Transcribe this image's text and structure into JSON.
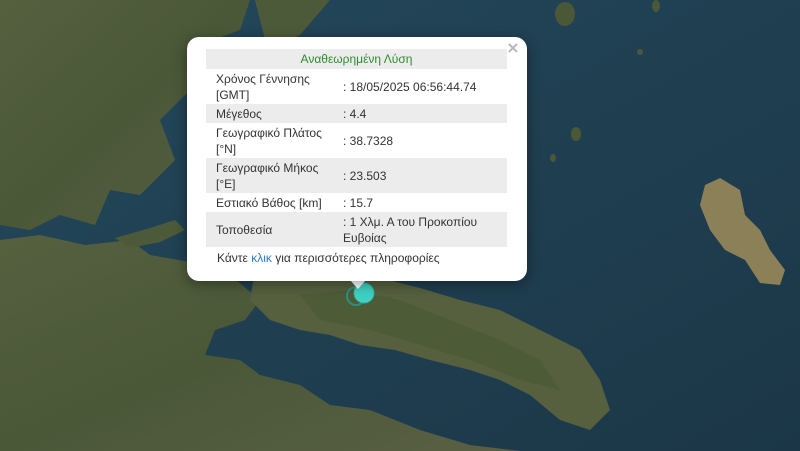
{
  "popup": {
    "title": "Αναθεωρημένη Λύση",
    "close_label": "×",
    "rows": [
      {
        "label": "Χρόνος Γέννησης [GMT]",
        "value": ": 18/05/2025 06:56:44.74"
      },
      {
        "label": "Μέγεθος",
        "value": ": 4.4"
      },
      {
        "label": "Γεωγραφικό Πλάτος [°N]",
        "value": ": 38.7328"
      },
      {
        "label": "Γεωγραφικό Μήκος [°E]",
        "value": ": 23.503"
      },
      {
        "label": "Εστιακό Βάθος [km]",
        "value": ": 15.7"
      },
      {
        "label": "Τοποθεσία",
        "value": ": 1 Χλμ. Α του Προκοπίου Ευβοίας"
      }
    ],
    "more": {
      "prefix": "Κάντε ",
      "link": "κλικ",
      "suffix": " για περισσότερες πληροφορίες"
    }
  },
  "colors": {
    "title_green": "#2e8b2e",
    "link_blue": "#2a7ec1",
    "sea": "#1d3b4d",
    "land": "#4a5838",
    "marker": "#3fd1c2"
  },
  "marker": {
    "icon": "earthquake-marker-icon"
  }
}
